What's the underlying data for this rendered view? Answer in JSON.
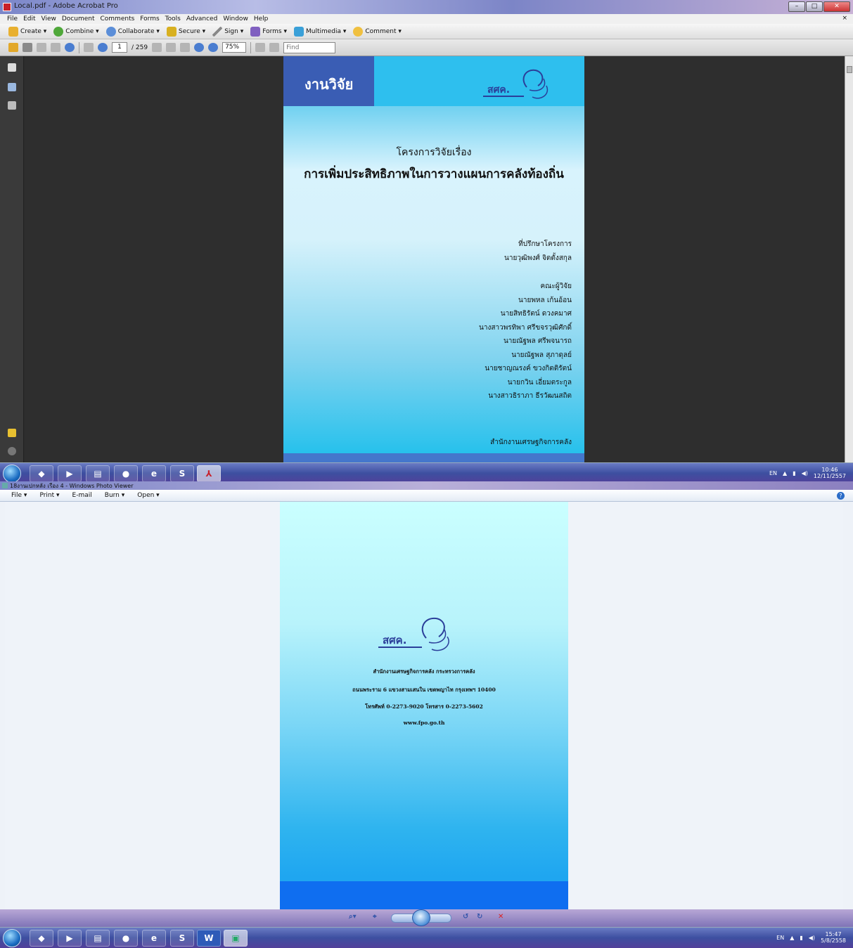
{
  "acrobat": {
    "title": "Local.pdf - Adobe Acrobat Pro",
    "menu": [
      "File",
      "Edit",
      "View",
      "Document",
      "Comments",
      "Forms",
      "Tools",
      "Advanced",
      "Window",
      "Help"
    ],
    "doc_close": "×",
    "toolbar": [
      {
        "label": "Create ▾",
        "icon": "create-icon"
      },
      {
        "label": "Combine ▾",
        "icon": "combine-icon"
      },
      {
        "label": "Collaborate ▾",
        "icon": "collaborate-icon"
      },
      {
        "label": "Secure ▾",
        "icon": "secure-icon"
      },
      {
        "label": "Sign ▾",
        "icon": "sign-icon"
      },
      {
        "label": "Forms ▾",
        "icon": "forms-icon"
      },
      {
        "label": "Multimedia ▾",
        "icon": "multimedia-icon"
      },
      {
        "label": "Comment ▾",
        "icon": "comment-icon"
      }
    ],
    "page_current": "1",
    "page_total": "/ 259",
    "zoom": "75%",
    "find_placeholder": "Find",
    "pdf": {
      "tag": "งานวิจัย",
      "logo_text": "สศค.",
      "title_small": "โครงการวิจัยเรื่อง",
      "title_big": "การเพิ่มประสิทธิภาพในการวางแผนการคลังท้องถิ่น",
      "advisor_heading": "ที่ปรึกษาโครงการ",
      "advisor": "นายวุฒิพงศ์ จิตตั้งสกุล",
      "team_heading": "คณะผู้วิจัย",
      "team": [
        "นายพหล เก้นอ้อน",
        "นายสิทธิรัตน์ ดวงคมาศ",
        "นางสาวพรทิพา ศรีขจรวุฒิศักดิ์",
        "นายณัฐพล ศรีพจนารถ",
        "นายณัฐพล สุภาดุลย์",
        "นายชาญณรงค์ ขวงกิตติรัตน์",
        "นายกวิน เอี่ยมตระกูล",
        "นางสาวธิราภา ธีรวัฒนสถิต"
      ],
      "office": "สำนักงานเศรษฐกิจการคลัง"
    }
  },
  "taskbar_top": {
    "lang": "EN",
    "time": "10:46",
    "date": "12/11/2557"
  },
  "photoviewer": {
    "title": "18งานเปกหลัง เรือง 4 - Windows Photo Viewer",
    "menu": [
      "File ▾",
      "Print ▾",
      "E-mail",
      "Burn ▾",
      "Open ▾"
    ],
    "help": "?",
    "logo_text": "สศค.",
    "lines": [
      "สำนักงานเศรษฐกิจการคลัง กระทรวงการคลัง",
      "ถนนพระราม 6 แขวงสามเสนใน เขตพญาไท กรุงเทพฯ 10400",
      "โทรศัพท์ 0-2273-9020 โทรสาร 0-2273-5602",
      "www.fpo.go.th"
    ]
  },
  "taskbar_bottom": {
    "lang": "EN",
    "time": "15:47",
    "date": "5/8/2558"
  }
}
